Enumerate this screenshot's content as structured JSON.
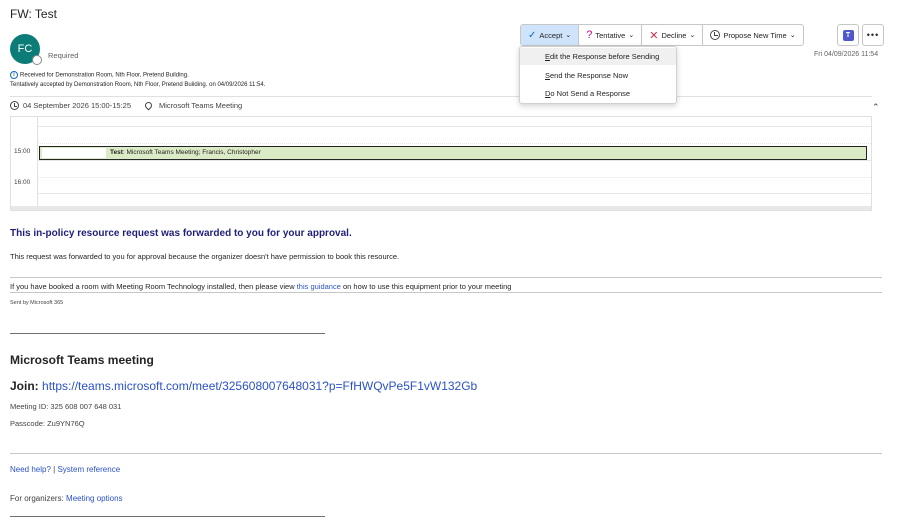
{
  "header": {
    "subject": "FW: Test",
    "avatar_initials": "FC",
    "required_label": "Required",
    "received_date": "Fri 04/09/2026 11:54"
  },
  "info": {
    "line1": "Received for Demonstration Room, Nth Floor, Pretend Building.",
    "line2": "Tentatively accepted by Demonstration Room, Nth Floor, Pretend Building. on 04/09/2026 11:54."
  },
  "meeting_when": {
    "datetime": "04 September 2026 15:00-15:25",
    "location": "Microsoft Teams Meeting"
  },
  "toolbar": {
    "accept_label": "Accept",
    "tentative_label": "Tentative",
    "decline_label": "Decline",
    "propose_label": "Propose New Time"
  },
  "accept_menu": {
    "items": [
      {
        "label": "Edit the Response before Sending",
        "mnemonic": "E",
        "rest": "dit the Response before Sending"
      },
      {
        "label": "Send the Response Now",
        "mnemonic": "S",
        "rest": "end the Response Now"
      },
      {
        "label": "Do Not Send a Response",
        "mnemonic": "D",
        "rest": "o Not Send a Response"
      }
    ]
  },
  "calendar": {
    "times": [
      "15:00",
      "16:00"
    ],
    "event_title": "Test",
    "event_detail": ": Microsoft Teams Meeting; Francis, Christopher"
  },
  "body": {
    "approval_heading": "This in-policy resource request was forwarded to you for your approval.",
    "approval_text": "This request was forwarded to you for approval because the organizer doesn't have permission to book this resource.",
    "guidance_pre": "If you have booked a room with Meeting Room Technology installed, then please view ",
    "guidance_link": "this guidance",
    "guidance_post": " on how to use this equipment prior to your meeting",
    "sent_by": "Sent by Microsoft 365"
  },
  "teams": {
    "heading": "Microsoft Teams meeting",
    "join_label": "Join:",
    "join_url": "https://teams.microsoft.com/meet/325608007648031?p=FfHWQvPe5F1vW132Gb",
    "meeting_id": "Meeting ID: 325 608 007 648 031",
    "passcode": "Passcode: Zu9YN76Q",
    "need_help": "Need help?",
    "separator": " | ",
    "system_reference": "System reference",
    "organizers_label": "For organizers: ",
    "meeting_options": "Meeting options"
  }
}
